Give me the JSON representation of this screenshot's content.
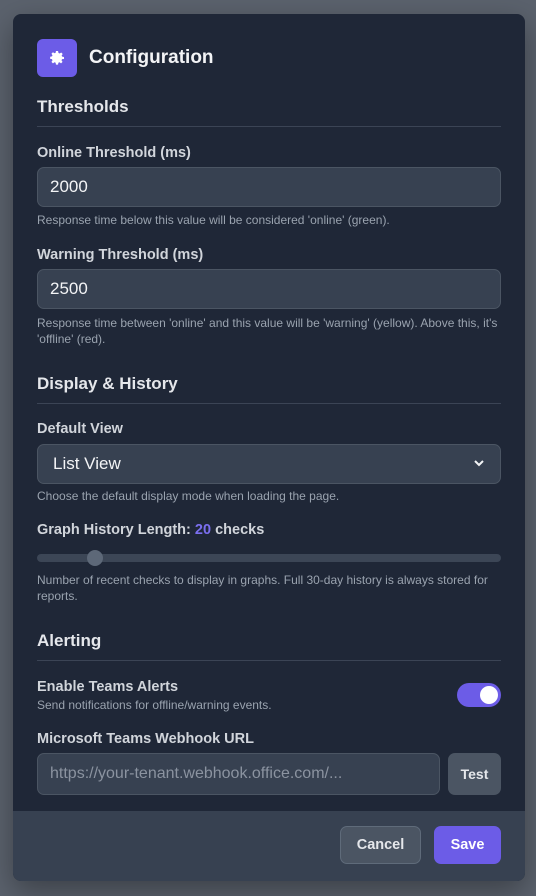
{
  "header": {
    "title": "Configuration",
    "icon": "gear-icon"
  },
  "thresholds": {
    "section_title": "Thresholds",
    "online": {
      "label": "Online Threshold (ms)",
      "value": "2000",
      "help": "Response time below this value will be considered 'online' (green)."
    },
    "warning": {
      "label": "Warning Threshold (ms)",
      "value": "2500",
      "help": "Response time between 'online' and this value will be 'warning' (yellow). Above this, it's 'offline' (red)."
    }
  },
  "display": {
    "section_title": "Display & History",
    "default_view": {
      "label": "Default View",
      "value": "List View",
      "help": "Choose the default display mode when loading the page."
    },
    "graph_history": {
      "label_prefix": "Graph History Length:",
      "value": "20",
      "label_suffix": "checks",
      "slider_fraction": 0.125,
      "help": "Number of recent checks to display in graphs. Full 30-day history is always stored for reports."
    }
  },
  "alerting": {
    "section_title": "Alerting",
    "teams_toggle": {
      "label": "Enable Teams Alerts",
      "help": "Send notifications for offline/warning events.",
      "enabled": true
    },
    "webhook": {
      "label": "Microsoft Teams Webhook URL",
      "placeholder": "https://your-tenant.webhook.office.com/...",
      "test_label": "Test"
    }
  },
  "footer": {
    "cancel_label": "Cancel",
    "save_label": "Save"
  },
  "colors": {
    "accent": "#6c5ce7",
    "background": "#1f2737"
  }
}
